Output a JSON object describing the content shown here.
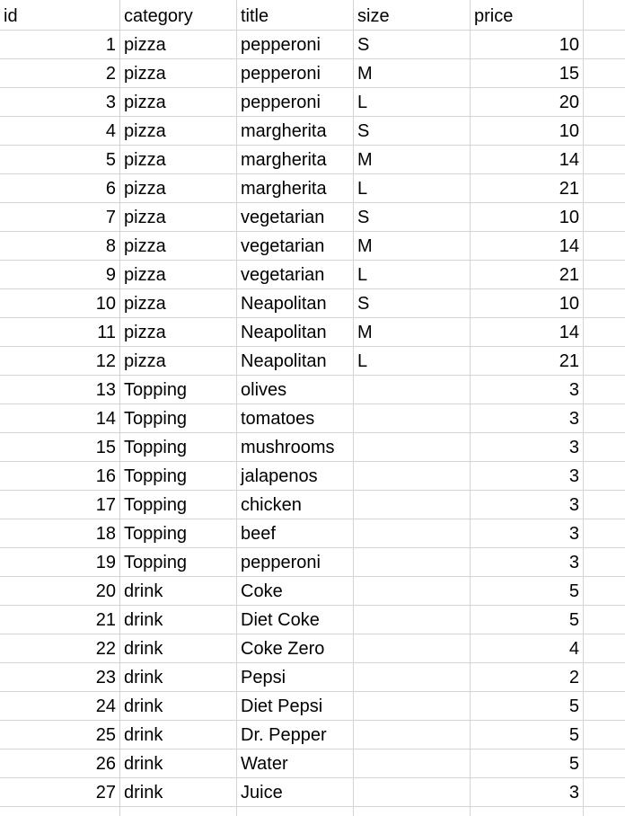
{
  "columns": {
    "id": "id",
    "category": "category",
    "title": "title",
    "size": "size",
    "price": "price"
  },
  "rows": [
    {
      "id": "1",
      "category": "pizza",
      "title": "pepperoni",
      "size": "S",
      "price": "10"
    },
    {
      "id": "2",
      "category": "pizza",
      "title": "pepperoni",
      "size": "M",
      "price": "15"
    },
    {
      "id": "3",
      "category": "pizza",
      "title": "pepperoni",
      "size": "L",
      "price": "20"
    },
    {
      "id": "4",
      "category": "pizza",
      "title": "margherita",
      "size": "S",
      "price": "10"
    },
    {
      "id": "5",
      "category": "pizza",
      "title": "margherita",
      "size": "M",
      "price": "14"
    },
    {
      "id": "6",
      "category": "pizza",
      "title": "margherita",
      "size": "L",
      "price": "21"
    },
    {
      "id": "7",
      "category": "pizza",
      "title": "vegetarian",
      "size": "S",
      "price": "10"
    },
    {
      "id": "8",
      "category": "pizza",
      "title": "vegetarian",
      "size": "M",
      "price": "14"
    },
    {
      "id": "9",
      "category": "pizza",
      "title": "vegetarian",
      "size": "L",
      "price": "21"
    },
    {
      "id": "10",
      "category": "pizza",
      "title": "Neapolitan",
      "size": "S",
      "price": "10"
    },
    {
      "id": "11",
      "category": "pizza",
      "title": "Neapolitan",
      "size": "M",
      "price": "14"
    },
    {
      "id": "12",
      "category": "pizza",
      "title": "Neapolitan",
      "size": "L",
      "price": "21"
    },
    {
      "id": "13",
      "category": "Topping",
      "title": "olives",
      "size": "",
      "price": "3"
    },
    {
      "id": "14",
      "category": "Topping",
      "title": "tomatoes",
      "size": "",
      "price": "3"
    },
    {
      "id": "15",
      "category": "Topping",
      "title": "mushrooms",
      "size": "",
      "price": "3"
    },
    {
      "id": "16",
      "category": "Topping",
      "title": "jalapenos",
      "size": "",
      "price": "3"
    },
    {
      "id": "17",
      "category": "Topping",
      "title": "chicken",
      "size": "",
      "price": "3"
    },
    {
      "id": "18",
      "category": "Topping",
      "title": "beef",
      "size": "",
      "price": "3"
    },
    {
      "id": "19",
      "category": "Topping",
      "title": "pepperoni",
      "size": "",
      "price": "3"
    },
    {
      "id": "20",
      "category": "drink",
      "title": "Coke",
      "size": "",
      "price": "5"
    },
    {
      "id": "21",
      "category": "drink",
      "title": "Diet Coke",
      "size": "",
      "price": "5"
    },
    {
      "id": "22",
      "category": "drink",
      "title": "Coke Zero",
      "size": "",
      "price": "4"
    },
    {
      "id": "23",
      "category": "drink",
      "title": "Pepsi",
      "size": "",
      "price": "2"
    },
    {
      "id": "24",
      "category": "drink",
      "title": "Diet Pepsi",
      "size": "",
      "price": "5"
    },
    {
      "id": "25",
      "category": "drink",
      "title": "Dr. Pepper",
      "size": "",
      "price": "5"
    },
    {
      "id": "26",
      "category": "drink",
      "title": "Water",
      "size": "",
      "price": "5"
    },
    {
      "id": "27",
      "category": "drink",
      "title": "Juice",
      "size": "",
      "price": "3"
    }
  ]
}
